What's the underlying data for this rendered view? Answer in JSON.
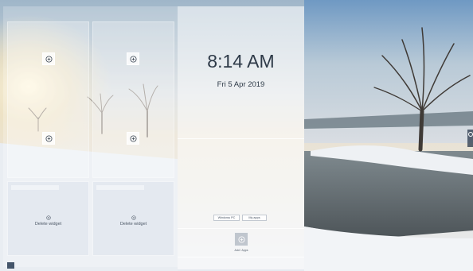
{
  "clock": {
    "time": "8:14 AM",
    "date": "Fri 5 Apr 2019"
  },
  "widget_slots": {
    "add_labels": [
      "",
      "",
      "",
      ""
    ]
  },
  "widgets": [
    {
      "delete_label": "Delete widget"
    },
    {
      "delete_label": "Delete widget"
    }
  ],
  "center_buttons": {
    "left_label": "Windows PC",
    "right_label": "My apps"
  },
  "add_app": {
    "label": "Add / Apps"
  },
  "colors": {
    "panel_text": "#2e3a48",
    "accent": "#44556a"
  },
  "icons": {
    "add": "plus-circle-icon",
    "delete": "plus-circle-icon",
    "edge": "toggle-icon"
  }
}
